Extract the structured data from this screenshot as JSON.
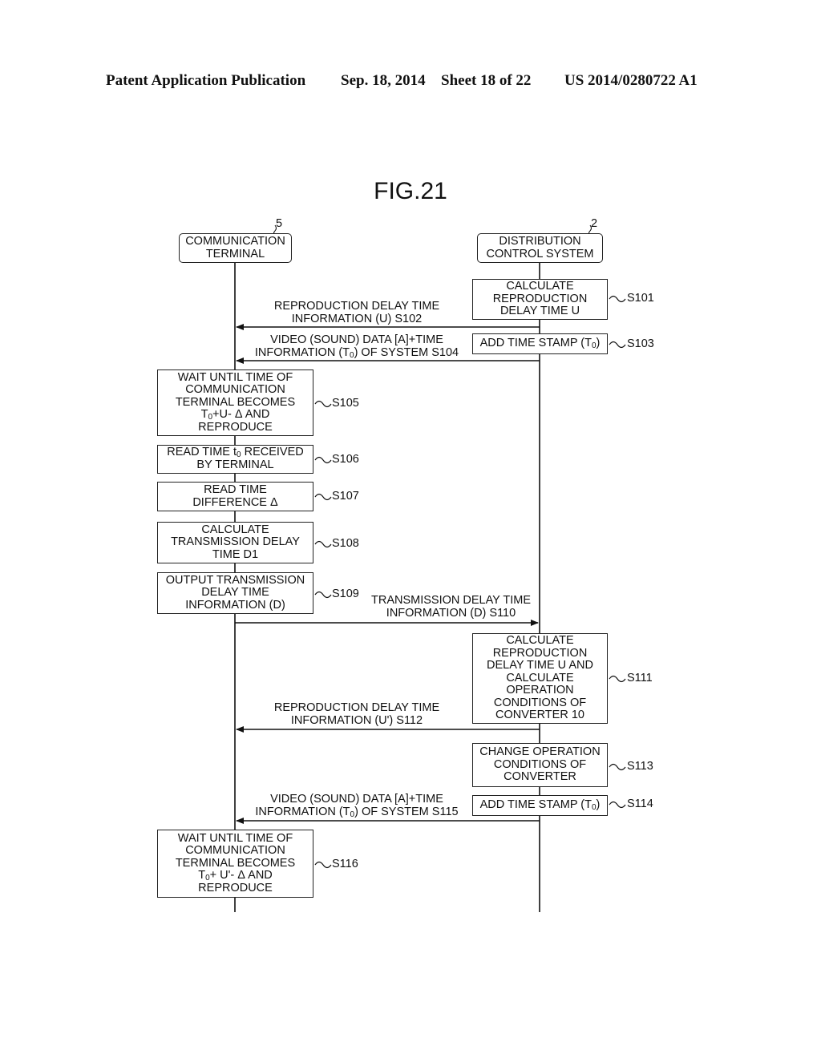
{
  "header": {
    "publication": "Patent Application Publication",
    "date": "Sep. 18, 2014",
    "sheet": "Sheet 18 of 22",
    "number": "US 2014/0280722 A1"
  },
  "figure": {
    "title": "FIG.21"
  },
  "actors": [
    {
      "id": "terminal",
      "ref": "5",
      "lines": [
        "COMMUNICATION",
        "TERMINAL"
      ]
    },
    {
      "id": "system",
      "ref": "2",
      "lines": [
        "DISTRIBUTION",
        "CONTROL SYSTEM"
      ]
    }
  ],
  "steps": {
    "s101": {
      "label": "S101",
      "lines": [
        "CALCULATE",
        "REPRODUCTION",
        "DELAY TIME U"
      ]
    },
    "s103": {
      "label": "S103",
      "text": "ADD TIME STAMP (T",
      "sub": "0",
      "after": ")"
    },
    "s105": {
      "label": "S105",
      "lines": [
        "WAIT UNTIL TIME OF",
        "COMMUNICATION",
        "TERMINAL BECOMES"
      ],
      "line4a": "T",
      "line4sub": "0",
      "line4b": "+U- Δ  AND",
      "line5": "REPRODUCE"
    },
    "s106": {
      "label": "S106",
      "line1a": "READ TIME t",
      "line1sub": "0",
      "line1b": " RECEIVED",
      "line2": "BY TERMINAL"
    },
    "s107": {
      "label": "S107",
      "lines": [
        "READ TIME",
        "DIFFERENCE  Δ"
      ]
    },
    "s108": {
      "label": "S108",
      "lines": [
        "CALCULATE",
        "TRANSMISSION DELAY",
        "TIME D1"
      ]
    },
    "s109": {
      "label": "S109",
      "lines": [
        "OUTPUT TRANSMISSION",
        "DELAY TIME",
        "INFORMATION (D)"
      ]
    },
    "s111": {
      "label": "S111",
      "lines": [
        "CALCULATE",
        "REPRODUCTION",
        "DELAY TIME U AND",
        "CALCULATE",
        "OPERATION",
        "CONDITIONS OF",
        "CONVERTER 10"
      ]
    },
    "s113": {
      "label": "S113",
      "lines": [
        "CHANGE OPERATION",
        "CONDITIONS OF",
        "CONVERTER"
      ]
    },
    "s114": {
      "label": "S114",
      "text": "ADD TIME STAMP (T",
      "sub": "0",
      "after": ")"
    },
    "s116": {
      "label": "S116",
      "lines": [
        "WAIT UNTIL TIME OF",
        "COMMUNICATION",
        "TERMINAL BECOMES"
      ],
      "line4a": "T",
      "line4sub": "0",
      "line4b": "+ U'- Δ  AND",
      "line5": "REPRODUCE"
    }
  },
  "messages": {
    "s102": {
      "line1": "REPRODUCTION DELAY TIME",
      "line2": "INFORMATION (U) S102",
      "direction": "system-to-terminal"
    },
    "s104": {
      "line1": "VIDEO (SOUND) DATA [A]+TIME",
      "line2a": "INFORMATION (T",
      "line2sub": "0",
      "line2b": ") OF SYSTEM S104",
      "direction": "system-to-terminal"
    },
    "s110": {
      "line1": "TRANSMISSION DELAY TIME",
      "line2": "INFORMATION (D) S110",
      "direction": "terminal-to-system"
    },
    "s112": {
      "line1": "REPRODUCTION DELAY TIME",
      "line2": "INFORMATION (U') S112",
      "direction": "system-to-terminal"
    },
    "s115": {
      "line1": "VIDEO (SOUND) DATA [A]+TIME",
      "line2a": "INFORMATION (T",
      "line2sub": "0",
      "line2b": ") OF SYSTEM S115",
      "direction": "system-to-terminal"
    }
  }
}
